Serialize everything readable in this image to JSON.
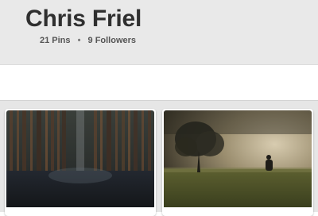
{
  "profile": {
    "name": "Chris Friel",
    "pins_label": "21 Pins",
    "separator": "•",
    "followers_label": "9 Followers"
  },
  "pins": [
    {
      "image": "forest-trees-photo",
      "alt": "Blurred forest of tall trees"
    },
    {
      "image": "lone-tree-field-photo",
      "alt": "Lone tree in a field at dusk"
    }
  ]
}
